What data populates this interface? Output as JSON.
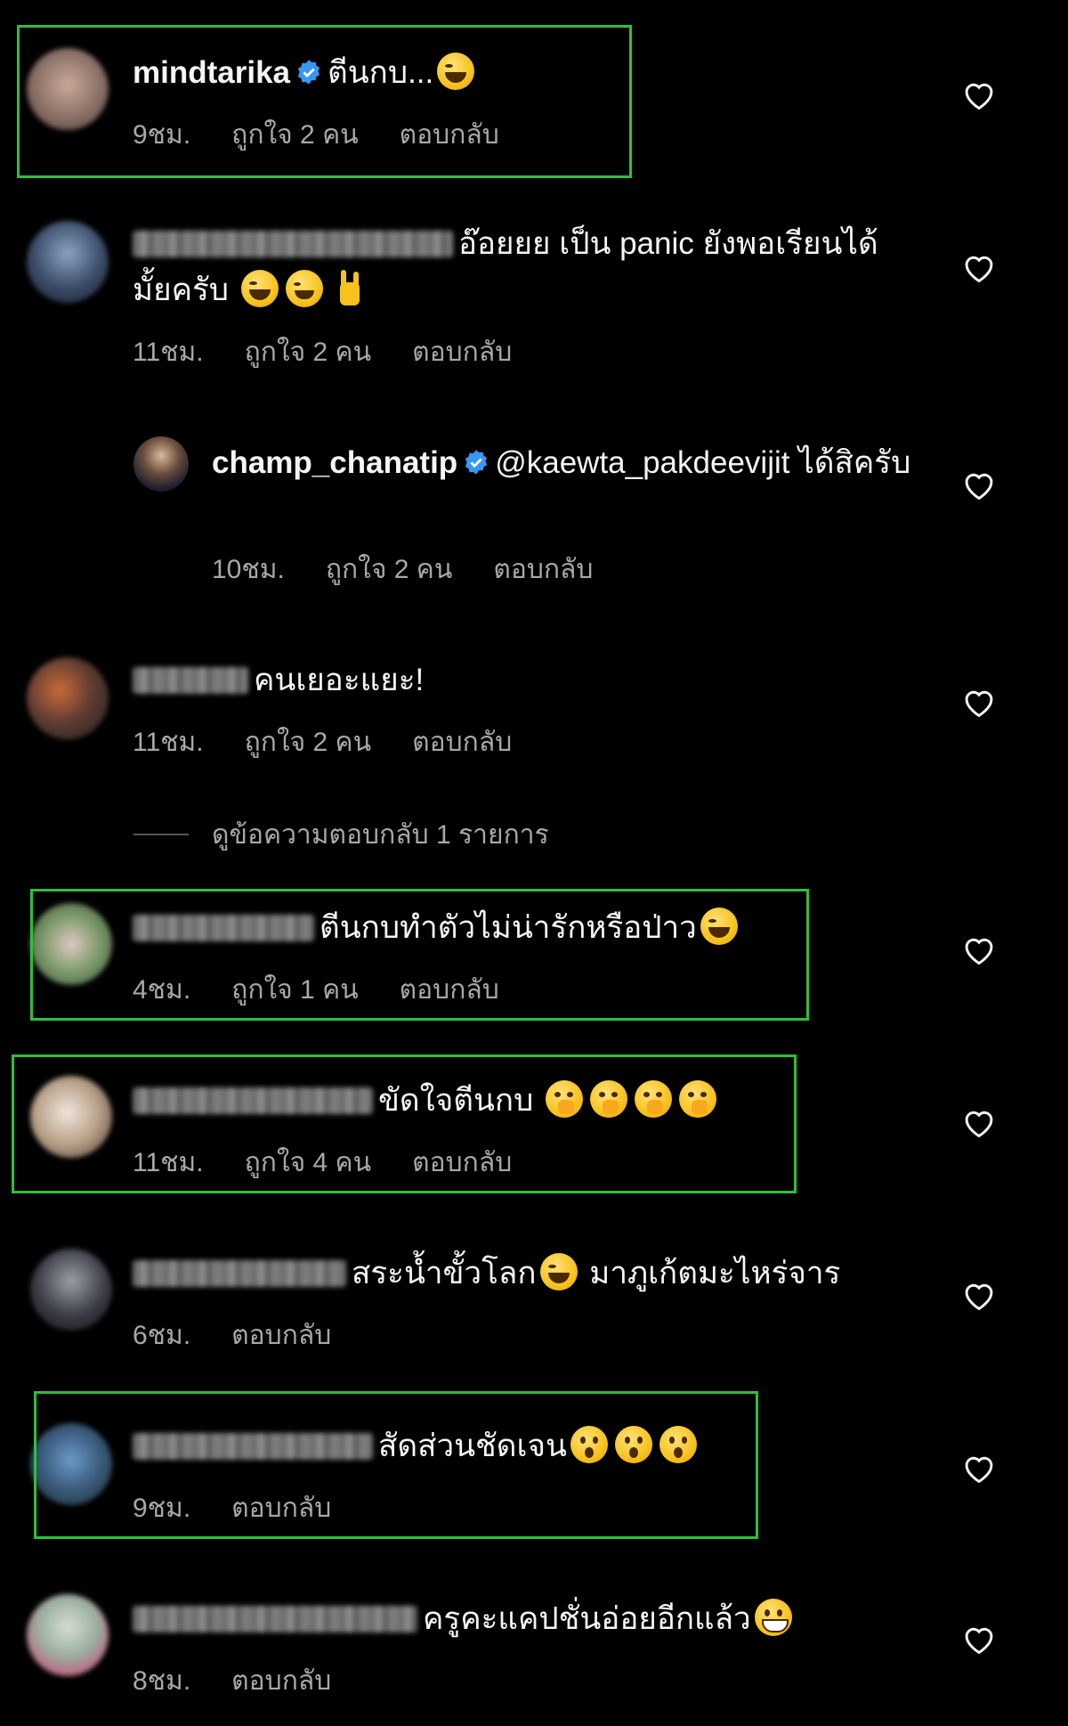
{
  "comments": [
    {
      "username": "mindtarika",
      "verified": true,
      "text": "ตีนกบ...",
      "emojis": [
        "laugh"
      ],
      "time": "9ชม.",
      "likes": "ถูกใจ 2 คน",
      "reply": "ตอบกลับ"
    },
    {
      "username": "",
      "verified": false,
      "text": "อ๊อยยย เป็น panic ยังพอเรียนได้มั้ยครับ",
      "emojis": [
        "laugh",
        "sweat",
        "rock"
      ],
      "time": "11ชม.",
      "likes": "ถูกใจ 2 คน",
      "reply": "ตอบกลับ"
    },
    {
      "username": "champ_chanatip",
      "verified": true,
      "text": "@kaewta_pakdeevijit ได้สิครับ",
      "emojis": [],
      "time": "10ชม.",
      "likes": "ถูกใจ 2 คน",
      "reply": "ตอบกลับ"
    },
    {
      "username": "",
      "verified": false,
      "text": "คนเยอะแยะ!",
      "emojis": [],
      "time": "11ชม.",
      "likes": "ถูกใจ 2 คน",
      "reply": "ตอบกลับ"
    },
    {
      "username": "",
      "verified": false,
      "text": "ตีนกบทำตัวไม่น่ารักหรือป่าว",
      "emojis": [
        "laugh"
      ],
      "time": "4ชม.",
      "likes": "ถูกใจ 1 คน",
      "reply": "ตอบกลับ"
    },
    {
      "username": "",
      "verified": false,
      "text": "ขัดใจตีนกบ",
      "emojis": [
        "shush",
        "shush",
        "shush",
        "shush"
      ],
      "time": "11ชม.",
      "likes": "ถูกใจ 4 คน",
      "reply": "ตอบกลับ"
    },
    {
      "username": "",
      "verified": false,
      "text": "สระน้ำขั้วโลก",
      "text2": "มาภูเก้ตมะไหร่จาร",
      "emojis": [
        "laugh"
      ],
      "time": "6ชม.",
      "reply": "ตอบกลับ"
    },
    {
      "username": "",
      "verified": false,
      "text": "สัดส่วนชัดเจน",
      "emojis": [
        "wow",
        "wow",
        "wow"
      ],
      "time": "9ชม.",
      "reply": "ตอบกลับ"
    },
    {
      "username": "",
      "verified": false,
      "text": "ครูคะแคปชั่นอ่อยอีกแล้ว",
      "emojis": [
        "grin"
      ],
      "time": "8ชม.",
      "reply": "ตอบกลับ"
    }
  ],
  "view_replies": "ดูข้อความตอบกลับ 1 รายการ",
  "colors": {
    "background": "#000000",
    "highlight": "#2fbf3a",
    "verified": "#3897f0",
    "meta": "#a8a8a8"
  }
}
